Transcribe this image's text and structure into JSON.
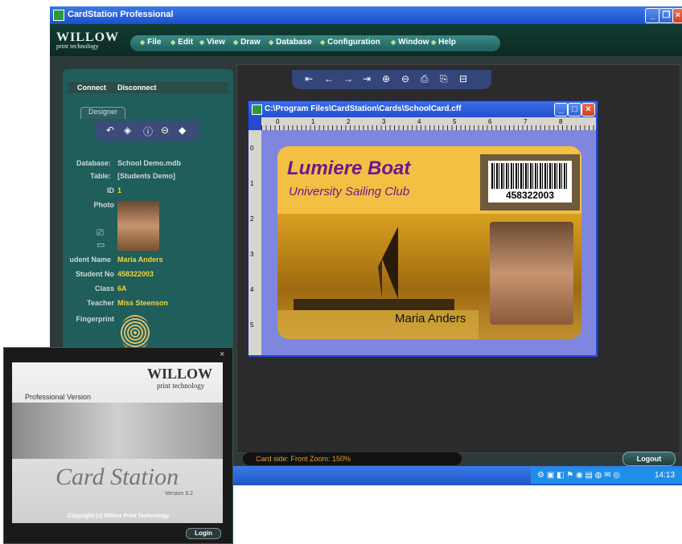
{
  "window": {
    "title": "CardStation Professional",
    "controls": [
      "minimize",
      "restore",
      "close"
    ]
  },
  "logo": {
    "brand": "WILLOW",
    "sub": "print technology"
  },
  "menu": [
    "File",
    "Edit",
    "View",
    "Draw",
    "Database",
    "Configuration",
    "Window",
    "Help"
  ],
  "connection": {
    "connect": "Connect",
    "disconnect": "Disconnect"
  },
  "designer": {
    "tab": "Designer",
    "tools": [
      "undo-icon",
      "layers-icon",
      "help-icon",
      "minus-icon",
      "brush-icon"
    ]
  },
  "record": {
    "database_label": "Database:",
    "database_value": "School Demo.mdb",
    "table_label": "Table:",
    "table_value": "[Students Demo]",
    "id_label": "ID",
    "id_value": "1",
    "photo_label": "Photo",
    "name_label": "udent Name",
    "name_value": "Maria Anders",
    "no_label": "Student No",
    "no_value": "458322003",
    "class_label": "Class",
    "class_value": "6A",
    "teacher_label": "Teacher",
    "teacher_value": "Miss Steenson",
    "fingerprint_label": "Fingerprint"
  },
  "toolbar": [
    "first-icon",
    "prev-icon",
    "next-icon",
    "last-icon",
    "zoom-in-icon",
    "zoom-out-icon",
    "print-icon",
    "print-setup-icon",
    "minus-icon"
  ],
  "document": {
    "title": "C:\\Program Files\\CardStation\\Cards\\SchoolCard.cff",
    "ruler_h": [
      "0",
      "1",
      "2",
      "3",
      "4",
      "5",
      "6",
      "7",
      "8"
    ],
    "ruler_v": [
      "0",
      "1",
      "2",
      "3",
      "4",
      "5"
    ]
  },
  "card": {
    "title": "Lumiere Boat",
    "subtitle": "University Sailing Club",
    "barcode": "458322003",
    "name": "Maria Anders"
  },
  "status": {
    "text": "Card side: Front   Zoom: 150%"
  },
  "logout": "Logout",
  "tray": {
    "time": "14:13"
  },
  "splash": {
    "brand": "WILLOW",
    "sub": "print technology",
    "edition": "Professional Version",
    "product": "Card Station",
    "version": "Version 3.2",
    "copyright": "Copyright (c) Willow Print Technology",
    "login": "Login",
    "close": "×"
  },
  "colors": {
    "accent": "#1f5e5a",
    "field_value": "#f3d53c",
    "card_title": "#6a1a8a"
  }
}
